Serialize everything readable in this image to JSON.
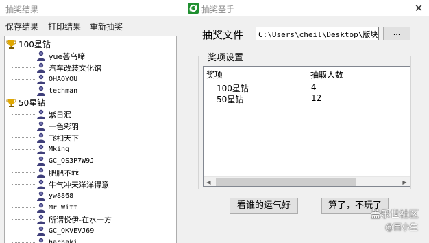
{
  "results_window": {
    "title": "抽奖结果",
    "menu": [
      "保存结果",
      "打印结果",
      "重新抽奖"
    ],
    "groups": [
      {
        "name": "100星钻",
        "icon": "trophy-icon",
        "winners": [
          "yue荟乌啼",
          "汽车改装文化馆",
          "OHAOYOU",
          "techman"
        ]
      },
      {
        "name": "50星钻",
        "icon": "trophy-icon",
        "winners": [
          "紫日泯",
          "一色彩羽",
          "飞相天下",
          "Mking",
          "GC_QS3P7W9J",
          "肥肥不乖",
          "牛气冲天洋洋得意",
          "yw8868",
          "Mr_Witt",
          "所谓悦伊-在水一方",
          "GC_QKVEVJ69",
          "hachaki"
        ]
      }
    ]
  },
  "lottery_window": {
    "title": "抽奖圣手",
    "close_symbol": "✕",
    "file_label": "抽奖文件",
    "file_path": "C:\\Users\\cheil\\Desktop\\版块活",
    "browse_label": "...",
    "prize_group_title": "奖项设置",
    "columns": [
      "奖项",
      "抽取人数"
    ],
    "prizes": [
      {
        "name": "100星钻",
        "count": "4"
      },
      {
        "name": "50星钻",
        "count": "12"
      }
    ],
    "lucky_button": "看谁的运气好",
    "quit_button": "算了，不玩了"
  },
  "watermark": {
    "line1": "盖乐世社区",
    "line2": "@百小生"
  },
  "colors": {
    "window_bg": "#f0f0f0",
    "title_text": "#8c8c8c",
    "trophy": "#e0a800",
    "user_icon": "#3f3f7a",
    "app_icon": "#1f8f2f"
  }
}
